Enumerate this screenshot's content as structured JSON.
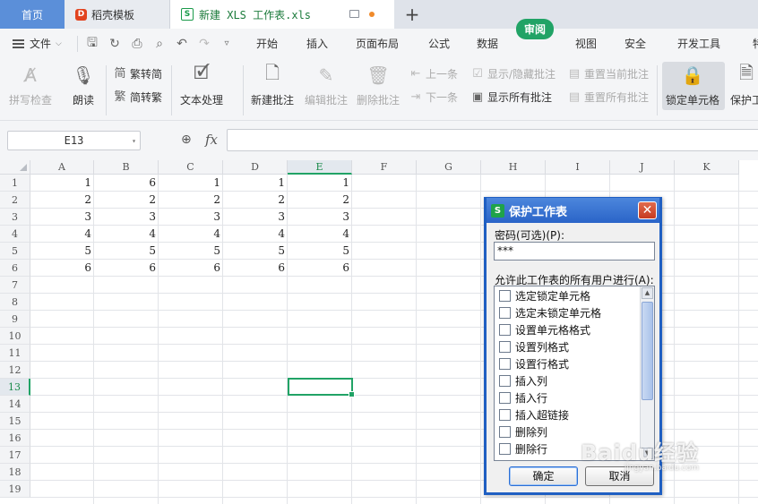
{
  "tabs": {
    "home": "首页",
    "docer": "稻壳模板",
    "active": "新建 XLS 工作表.xls",
    "plus": "+"
  },
  "menu": {
    "file_label": "文件",
    "quick_access_icons": [
      "save-icon",
      "redo-format-icon",
      "print-icon",
      "print-preview-icon",
      "undo-icon",
      "redo-icon",
      "more-icon"
    ],
    "items": [
      "开始",
      "插入",
      "页面布局",
      "公式",
      "数据",
      "审阅",
      "视图",
      "安全",
      "开发工具",
      "特"
    ],
    "active_item": "审阅"
  },
  "ribbon": {
    "spell_check": "拼写检查",
    "read_aloud": "朗读",
    "trad_to_simp": "繁转简",
    "simp_to_trad": "简转繁",
    "text_processing": "文本处理",
    "new_comment": "新建批注",
    "edit_comment": "编辑批注",
    "delete_comment": "删除批注",
    "prev": "上一条",
    "next": "下一条",
    "show_hide_comment": "显示/隐藏批注",
    "show_all_comments": "显示所有批注",
    "reset_current_comment": "重置当前批注",
    "reset_all_comments": "重置所有批注",
    "lock_cell": "锁定单元格",
    "protect_sheet": "保护工"
  },
  "formula_bar": {
    "name_box": "E13",
    "fx": "fx",
    "formula": ""
  },
  "grid": {
    "columns": [
      "A",
      "B",
      "C",
      "D",
      "E",
      "F",
      "G",
      "H",
      "I",
      "J",
      "K"
    ],
    "rows": [
      "1",
      "2",
      "3",
      "4",
      "5",
      "6",
      "7",
      "8",
      "9",
      "10",
      "11",
      "12",
      "13",
      "14",
      "15",
      "16",
      "17",
      "18",
      "19"
    ],
    "selected_cell": "E13",
    "data": [
      [
        "1",
        "6",
        "1",
        "1",
        "1"
      ],
      [
        "2",
        "2",
        "2",
        "2",
        "2"
      ],
      [
        "3",
        "3",
        "3",
        "3",
        "3"
      ],
      [
        "4",
        "4",
        "4",
        "4",
        "4"
      ],
      [
        "5",
        "5",
        "5",
        "5",
        "5"
      ],
      [
        "6",
        "6",
        "6",
        "6",
        "6"
      ]
    ]
  },
  "dialog": {
    "title": "保护工作表",
    "close": "✕",
    "password_label": "密码(可选)(P):",
    "password_value": "***",
    "allow_label": "允许此工作表的所有用户进行(A):",
    "options": [
      "选定锁定单元格",
      "选定未锁定单元格",
      "设置单元格格式",
      "设置列格式",
      "设置行格式",
      "插入列",
      "插入行",
      "插入超链接",
      "删除列",
      "删除行"
    ],
    "ok": "确定",
    "cancel": "取消"
  },
  "watermark": {
    "text": "Baidu经验",
    "sub": "jingyan.baidu.com"
  }
}
